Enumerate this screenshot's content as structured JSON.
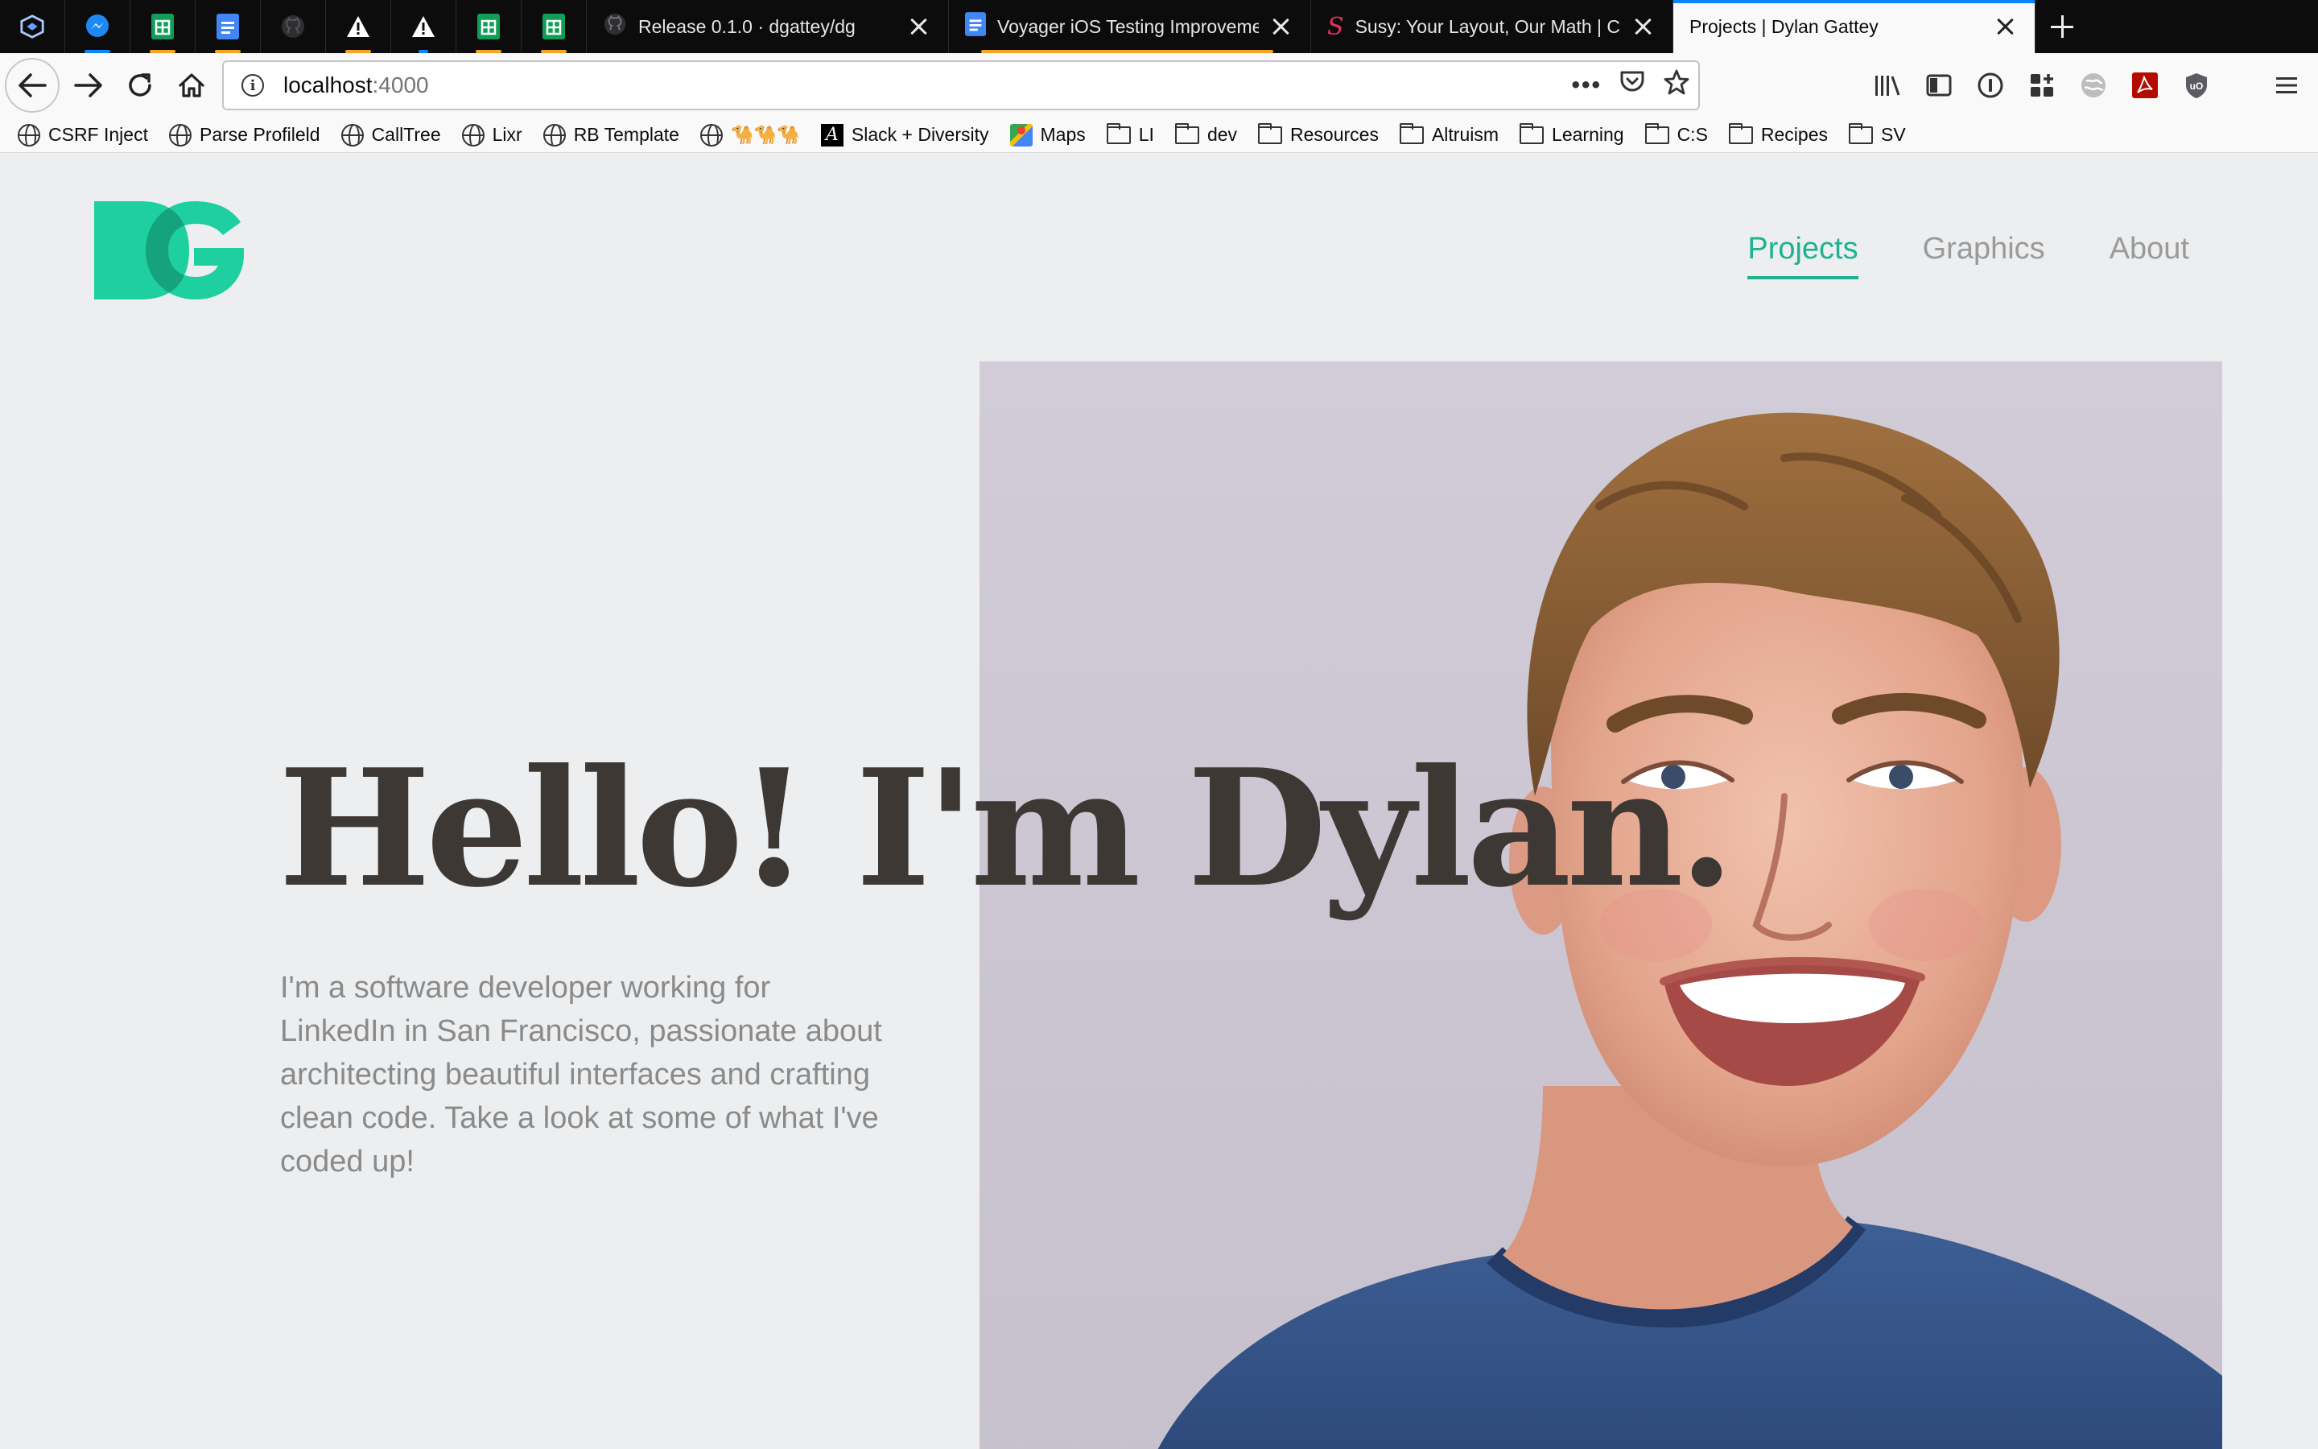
{
  "browser": {
    "pinned_tabs": [
      {
        "icon": "account-container-icon",
        "color": "#2a5db0"
      },
      {
        "icon": "messenger-icon",
        "color": "#0084ff",
        "underline": "#0a84ff"
      },
      {
        "icon": "google-sheets-icon",
        "color": "#0f9d58",
        "underline": "#f5a623"
      },
      {
        "icon": "google-docs-icon",
        "color": "#4285f4",
        "underline": "#f5a623"
      },
      {
        "icon": "github-icon",
        "color": "#333333"
      },
      {
        "icon": "warning-icon",
        "color": "#ffffff",
        "underline": "#f5a623"
      },
      {
        "icon": "warning-icon",
        "color": "#ffffff",
        "underline": "#0a84ff"
      },
      {
        "icon": "google-sheets-icon",
        "color": "#0f9d58",
        "underline": "#f5a623"
      },
      {
        "icon": "google-sheets-icon",
        "color": "#0f9d58",
        "underline": "#f5a623"
      }
    ],
    "tabs": [
      {
        "title": "Release 0.1.0 · dgattey/dg",
        "icon": "github-icon"
      },
      {
        "title": "Voyager iOS Testing Improveme",
        "icon": "google-docs-icon"
      },
      {
        "title": "Susy: Your Layout, Our Math | C",
        "icon": "susy-icon"
      },
      {
        "title": "Projects | Dylan Gattey",
        "icon": "none"
      }
    ],
    "url_host": "localhost",
    "url_port": ":4000",
    "bookmarks": [
      {
        "label": "CSRF Inject",
        "icon": "globe-icon"
      },
      {
        "label": "Parse Profileld",
        "icon": "globe-icon"
      },
      {
        "label": "CallTree",
        "icon": "globe-icon"
      },
      {
        "label": "Lixr",
        "icon": "globe-icon"
      },
      {
        "label": "RB Template",
        "icon": "globe-icon"
      },
      {
        "label": "🐪🐪🐪",
        "icon": "globe-icon"
      },
      {
        "label": "Slack + Diversity",
        "icon": "slack-icon"
      },
      {
        "label": "Maps",
        "icon": "maps-icon"
      },
      {
        "label": "LI",
        "icon": "folder-icon"
      },
      {
        "label": "dev",
        "icon": "folder-icon"
      },
      {
        "label": "Resources",
        "icon": "folder-icon"
      },
      {
        "label": "Altruism",
        "icon": "folder-icon"
      },
      {
        "label": "Learning",
        "icon": "folder-icon"
      },
      {
        "label": "C:S",
        "icon": "folder-icon"
      },
      {
        "label": "Recipes",
        "icon": "folder-icon"
      },
      {
        "label": "SV",
        "icon": "folder-icon"
      }
    ]
  },
  "site": {
    "logo_text": "DG",
    "logo_color": "#1ecf9f",
    "accent": "#1db290",
    "nav": [
      {
        "label": "Projects",
        "active": true
      },
      {
        "label": "Graphics",
        "active": false
      },
      {
        "label": "About",
        "active": false
      }
    ],
    "headline": "Hello! I'm Dylan.",
    "intro": "I'm a software developer working for LinkedIn in San Francisco, passionate about architecting beautiful interfaces and crafting clean code. Take a look at some of what I've coded up!",
    "photo_alt": "Portrait of Dylan smiling"
  }
}
